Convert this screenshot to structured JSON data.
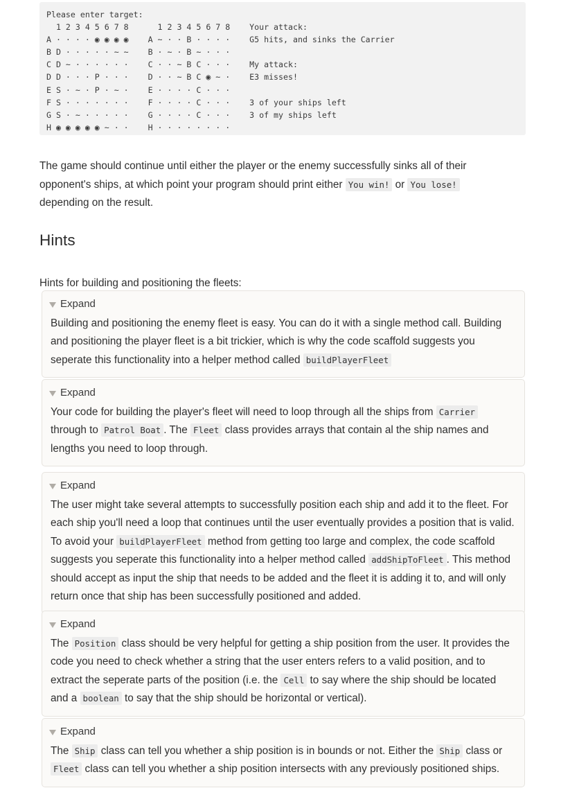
{
  "code_block": {
    "name": "battleship-game-output",
    "lines": [
      "Please enter target:",
      "  1 2 3 4 5 6 7 8      1 2 3 4 5 6 7 8    Your attack:",
      "A · · · · ◉ ◉ ◉ ◉    A ~ · · B · · · ·    G5 hits, and sinks the Carrier",
      "B D · · · · · ~ ~    B · ~ · B ~ · · ·",
      "C D ~ · · · · · ·    C · · ~ B C · · ·    My attack:",
      "D D · · · P · · ·    D · · ~ B C ◉ ~ ·    E3 misses!",
      "E S · ~ · P · ~ ·    E · · · · C · · ·",
      "F S · · · · · · ·    F · · · · C · · ·    3 of your ships left",
      "G S · ~ · · · · ·    G · · · · C · · ·    3 of my ships left",
      "H ◉ ◉ ◉ ◉ ◉ ~ · ·    H · · · · · · · ·"
    ],
    "prompt": "Please enter target:",
    "your_attack_label": "Your attack:",
    "your_attack_result": "G5 hits, and sinks the Carrier",
    "my_attack_label": "My attack:",
    "my_attack_result": "E3 misses!",
    "your_ships_left": "3 of your ships left",
    "my_ships_left": "3 of my ships left"
  },
  "continue_paragraph": {
    "part1": "The game should continue until either the player or the enemy successfully sinks all of their opponent's ships, at which point your program should print either ",
    "code_win": "You win!",
    "part2": " or ",
    "code_lose": "You lose!",
    "part3": " depending on the result."
  },
  "hints_section": {
    "title": "Hints",
    "intro": "Hints for building and positioning the fleets:"
  },
  "expand_boxes": [
    {
      "label": "Expand",
      "segments": [
        {
          "type": "text",
          "value": "Building and positioning the enemy fleet is easy. You can do it with a single method call. Building and positioning the player fleet is a bit trickier, which is why the code scaffold suggests you seperate this functionality into a helper method called "
        },
        {
          "type": "code",
          "value": "buildPlayerFleet"
        }
      ]
    },
    {
      "label": "Expand",
      "segments": [
        {
          "type": "text",
          "value": "Your code for building the player's fleet will need to loop through all the ships from "
        },
        {
          "type": "code",
          "value": "Carrier"
        },
        {
          "type": "text",
          "value": " through to "
        },
        {
          "type": "code",
          "value": "Patrol Boat"
        },
        {
          "type": "text",
          "value": ". The "
        },
        {
          "type": "code",
          "value": "Fleet"
        },
        {
          "type": "text",
          "value": " class provides arrays that contain al the ship names and lengths you need to loop through."
        }
      ]
    },
    {
      "label": "Expand",
      "segments": [
        {
          "type": "text",
          "value": "The user might take several attempts to successfully position each ship and add it to the fleet. For each ship you'll need a loop that continues until the user eventually provides a position that is valid. To avoid your "
        },
        {
          "type": "code",
          "value": "buildPlayerFleet"
        },
        {
          "type": "text",
          "value": " method from getting too large and complex, the code scaffold suggests you seperate this functionality into a helper method called "
        },
        {
          "type": "code",
          "value": "addShipToFleet"
        },
        {
          "type": "text",
          "value": ". This method should accept as input the ship that needs to be added and the fleet it is adding it to, and will only return once that ship has been successfully positioned and added."
        }
      ]
    },
    {
      "label": "Expand",
      "segments": [
        {
          "type": "text",
          "value": "The "
        },
        {
          "type": "code",
          "value": "Position"
        },
        {
          "type": "text",
          "value": " class should be very helpful for getting a ship position from the user. It provides the code you need to check whether a string that the user enters refers to a valid position, and to extract the seperate parts of the position (i.e. the "
        },
        {
          "type": "code",
          "value": "Cell"
        },
        {
          "type": "text",
          "value": " to say where the ship should be located and a "
        },
        {
          "type": "code",
          "value": "boolean"
        },
        {
          "type": "text",
          "value": " to say that the ship should be horizontal or vertical)."
        }
      ]
    },
    {
      "label": "Expand",
      "segments": [
        {
          "type": "text",
          "value": "The "
        },
        {
          "type": "code",
          "value": "Ship"
        },
        {
          "type": "text",
          "value": " class can tell you whether a ship position is in bounds or not. Either the "
        },
        {
          "type": "code",
          "value": "Ship"
        },
        {
          "type": "text",
          "value": " class or "
        },
        {
          "type": "code",
          "value": "Fleet"
        },
        {
          "type": "text",
          "value": " class can tell you whether a ship position intersects with any previously positioned ships."
        }
      ]
    }
  ],
  "colors": {
    "code_block_bg": "#f2f2f2",
    "inline_code_bg": "#ececec",
    "expand_box_bg": "#fbfaf8",
    "expand_box_border": "#e6e3de",
    "triangle": "#b0aca6",
    "text": "#2f2f2f"
  }
}
